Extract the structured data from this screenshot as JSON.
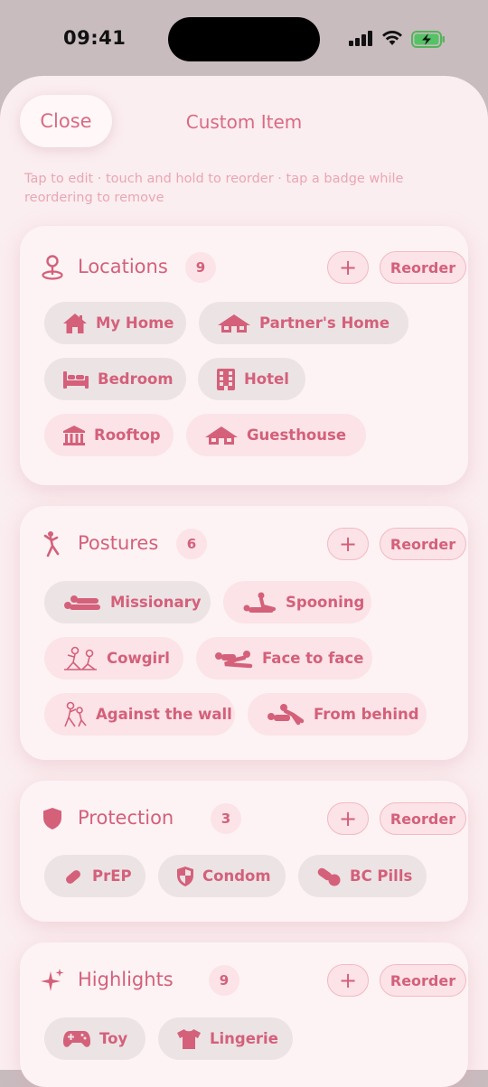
{
  "status_bar": {
    "time": "09:41"
  },
  "header": {
    "close_label": "Close",
    "title": "Custom Item"
  },
  "hint": "Tap to edit · touch and hold to reorder · tap a badge while reordering to remove",
  "colors": {
    "accent": "#d4607a",
    "sheet": "#fbeef0",
    "chip_gray": "#ece3e5",
    "chip_pink": "#fbe3e7"
  },
  "sections": {
    "locations": {
      "title": "Locations",
      "count": "9",
      "icon": "map-pin-icon",
      "add_label": "+",
      "reorder_label": "Reorder",
      "items": [
        {
          "label": "My Home",
          "icon": "house-icon"
        },
        {
          "label": "Partner's Home",
          "icon": "house-wide-icon"
        },
        {
          "label": "Bedroom",
          "icon": "bed-icon"
        },
        {
          "label": "Hotel",
          "icon": "building-icon"
        },
        {
          "label": "Rooftop",
          "icon": "columns-building-icon"
        },
        {
          "label": "Guesthouse",
          "icon": "house-wide-icon"
        }
      ]
    },
    "postures": {
      "title": "Postures",
      "count": "6",
      "icon": "figure-icon",
      "add_label": "+",
      "reorder_label": "Reorder",
      "items": [
        {
          "label": "Missionary",
          "icon": "posture-icon"
        },
        {
          "label": "Spooning",
          "icon": "posture-icon"
        },
        {
          "label": "Cowgirl",
          "icon": "posture-icon"
        },
        {
          "label": "Face to face",
          "icon": "posture-icon"
        },
        {
          "label": "Against the wall",
          "icon": "posture-icon"
        },
        {
          "label": "From behind",
          "icon": "posture-icon"
        }
      ]
    },
    "protection": {
      "title": "Protection",
      "count": "3",
      "icon": "shield-icon",
      "add_label": "+",
      "reorder_label": "Reorder",
      "items": [
        {
          "label": "PrEP",
          "icon": "pill-icon"
        },
        {
          "label": "Condom",
          "icon": "checkered-shield-icon"
        },
        {
          "label": "BC Pills",
          "icon": "pills-icon"
        }
      ]
    },
    "highlights": {
      "title": "Highlights",
      "count": "9",
      "icon": "sparkles-icon",
      "add_label": "+",
      "reorder_label": "Reorder",
      "items": [
        {
          "label": "Toy",
          "icon": "gamepad-icon"
        },
        {
          "label": "Lingerie",
          "icon": "tshirt-icon"
        }
      ]
    }
  }
}
